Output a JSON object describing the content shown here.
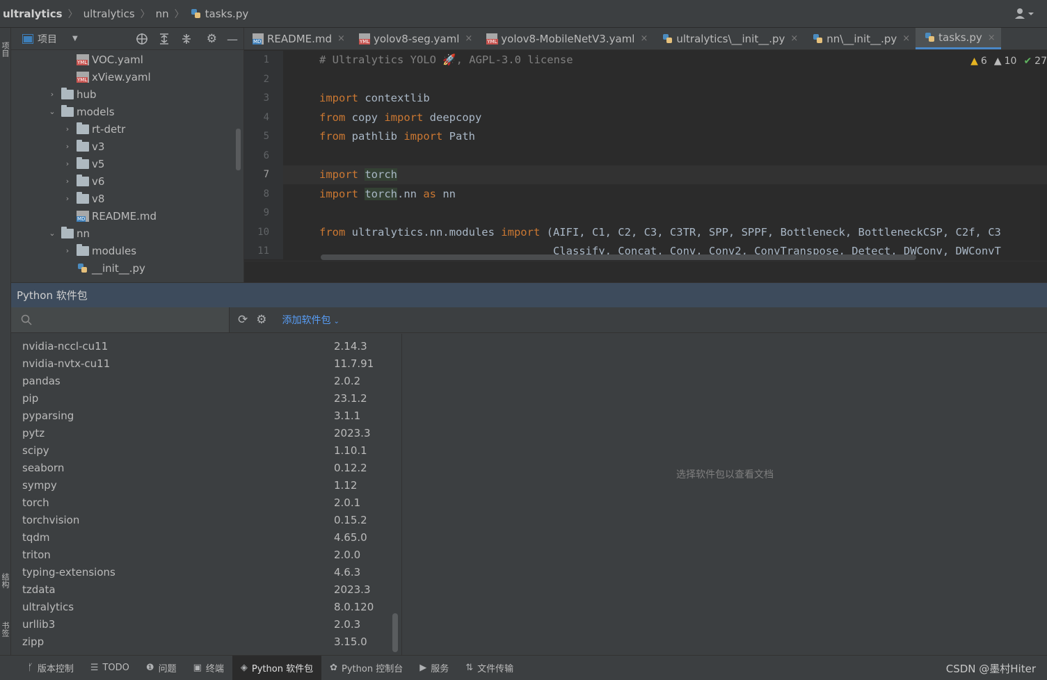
{
  "breadcrumb": [
    "ultralytics",
    "ultralytics",
    "nn",
    "tasks.py"
  ],
  "project": {
    "label": "项目",
    "tree": [
      {
        "label": "VOC.yaml",
        "type": "yml",
        "depth": 3,
        "arrow": ""
      },
      {
        "label": "xView.yaml",
        "type": "yml",
        "depth": 3,
        "arrow": ""
      },
      {
        "label": "hub",
        "type": "folder",
        "depth": 2,
        "arrow": "›"
      },
      {
        "label": "models",
        "type": "folder",
        "depth": 2,
        "arrow": "⌄"
      },
      {
        "label": "rt-detr",
        "type": "folder",
        "depth": 3,
        "arrow": "›"
      },
      {
        "label": "v3",
        "type": "folder",
        "depth": 3,
        "arrow": "›"
      },
      {
        "label": "v5",
        "type": "folder",
        "depth": 3,
        "arrow": "›"
      },
      {
        "label": "v6",
        "type": "folder",
        "depth": 3,
        "arrow": "›"
      },
      {
        "label": "v8",
        "type": "folder",
        "depth": 3,
        "arrow": "›"
      },
      {
        "label": "README.md",
        "type": "md",
        "depth": 3,
        "arrow": ""
      },
      {
        "label": "nn",
        "type": "folder",
        "depth": 2,
        "arrow": "⌄"
      },
      {
        "label": "modules",
        "type": "folder",
        "depth": 3,
        "arrow": "›"
      },
      {
        "label": "__init__.py",
        "type": "py",
        "depth": 3,
        "arrow": ""
      }
    ]
  },
  "left_strip": {
    "top_label": "项目",
    "mid_label": "结构",
    "bottom_label": "书签"
  },
  "tabs": [
    {
      "label": "README.md",
      "type": "md",
      "active": false
    },
    {
      "label": "yolov8-seg.yaml",
      "type": "yml",
      "active": false
    },
    {
      "label": "yolov8-MobileNetV3.yaml",
      "type": "yml",
      "active": false
    },
    {
      "label": "ultralytics\\__init__.py",
      "type": "py",
      "active": false
    },
    {
      "label": "nn\\__init__.py",
      "type": "py",
      "active": false
    },
    {
      "label": "tasks.py",
      "type": "py",
      "active": true
    }
  ],
  "inspections": {
    "warnings": "6",
    "weak_warnings": "10",
    "ok": "27"
  },
  "code": {
    "line_numbers": [
      "1",
      "2",
      "3",
      "4",
      "5",
      "6",
      "7",
      "8",
      "9",
      "10",
      "11"
    ],
    "current_line": "7",
    "l1": "# Ultralytics YOLO 🚀, AGPL-3.0 license",
    "l3_kw": "import",
    "l3_rest": " contextlib",
    "l4_kw1": "from",
    "l4_mid": " copy ",
    "l4_kw2": "import",
    "l4_rest": " deepcopy",
    "l5_kw1": "from",
    "l5_mid": " pathlib ",
    "l5_kw2": "import",
    "l5_rest": " Path",
    "l7_kw": "import",
    "l7_rest": "torch",
    "l8_kw1": "import",
    "l8_hl": "torch",
    "l8_mid": ".nn ",
    "l8_kw2": "as",
    "l8_rest": " nn",
    "l10_kw1": "from",
    "l10_mid": " ultralytics.nn.modules ",
    "l10_kw2": "import",
    "l10_rest": " (AIFI, C1, C2, C3, C3TR, SPP, SPPF, Bottleneck, BottleneckCSP, C2f, C3",
    "l11": "                                    Classify, Concat, Conv, Conv2, ConvTranspose, Detect, DWConv, DWConvT"
  },
  "packages": {
    "title": "Python 软件包",
    "search_placeholder": "",
    "add_label": "添加软件包",
    "doc_placeholder": "选择软件包以查看文档",
    "rows": [
      {
        "name": "nvidia-nccl-cu11",
        "version": "2.14.3"
      },
      {
        "name": "nvidia-nvtx-cu11",
        "version": "11.7.91"
      },
      {
        "name": "pandas",
        "version": "2.0.2"
      },
      {
        "name": "pip",
        "version": "23.1.2"
      },
      {
        "name": "pyparsing",
        "version": "3.1.1"
      },
      {
        "name": "pytz",
        "version": "2023.3"
      },
      {
        "name": "scipy",
        "version": "1.10.1"
      },
      {
        "name": "seaborn",
        "version": "0.12.2"
      },
      {
        "name": "sympy",
        "version": "1.12"
      },
      {
        "name": "torch",
        "version": "2.0.1"
      },
      {
        "name": "torchvision",
        "version": "0.15.2"
      },
      {
        "name": "tqdm",
        "version": "4.65.0"
      },
      {
        "name": "triton",
        "version": "2.0.0"
      },
      {
        "name": "typing-extensions",
        "version": "4.6.3"
      },
      {
        "name": "tzdata",
        "version": "2023.3"
      },
      {
        "name": "ultralytics",
        "version": "8.0.120"
      },
      {
        "name": "urllib3",
        "version": "2.0.3"
      },
      {
        "name": "zipp",
        "version": "3.15.0"
      }
    ]
  },
  "bottom_tools": [
    {
      "label": "版本控制",
      "icon": "branch-icon",
      "active": false
    },
    {
      "label": "TODO",
      "icon": "list-icon",
      "active": false
    },
    {
      "label": "问题",
      "icon": "problem-icon",
      "active": false
    },
    {
      "label": "终端",
      "icon": "terminal-icon",
      "active": false
    },
    {
      "label": "Python 软件包",
      "icon": "layers-icon",
      "active": true
    },
    {
      "label": "Python 控制台",
      "icon": "python-icon",
      "active": false
    },
    {
      "label": "服务",
      "icon": "play-icon",
      "active": false
    },
    {
      "label": "文件传输",
      "icon": "transfer-icon",
      "active": false
    }
  ],
  "watermark": "CSDN @墨村Hiter",
  "colors": {
    "keyword": "#cc7832",
    "comment": "#808080",
    "link": "#589df6",
    "active_tab_underline": "#4a88c7",
    "panel_header": "#3d4b5c"
  }
}
